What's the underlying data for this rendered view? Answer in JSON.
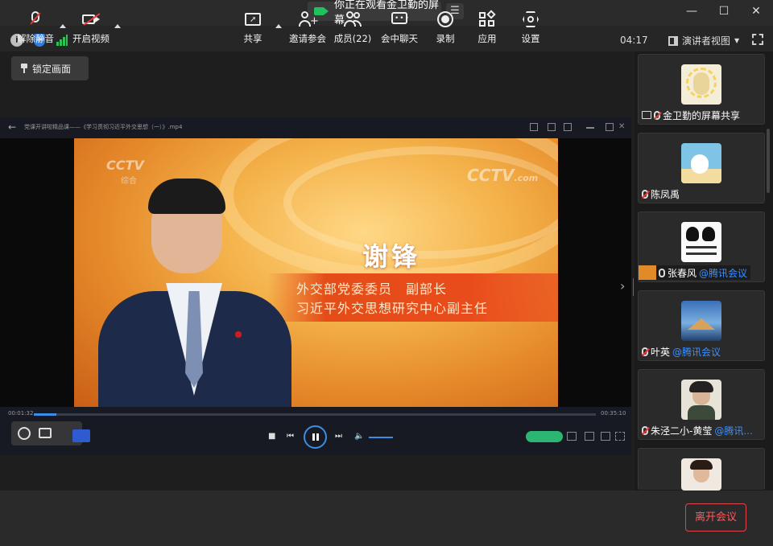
{
  "titlebar": {
    "sharing_text": "你正在观看金卫勤的屏幕"
  },
  "infobar": {
    "timer": "04:17",
    "view_mode": "演讲者视图"
  },
  "main": {
    "lock_label": "锁定画面"
  },
  "player": {
    "title": "党课开讲啦精品课——《学习贯彻习近平外交思想（一）》.mp4",
    "time_elapsed": "00:01:32",
    "time_total": "00:35:10",
    "progress_fraction": 0.04,
    "video": {
      "logo_left": "CCTV",
      "logo_left_sub": "综合",
      "logo_right": "CCTV",
      "logo_right_suffix": ".com",
      "speaker_name": "谢锋",
      "caption_line1": "外交部党委委员　副部长",
      "caption_line2": "习近平外交思想研究中心副主任"
    }
  },
  "participants": [
    {
      "name": "金卫勤的屏幕共享",
      "suffix": "",
      "mic": "muted"
    },
    {
      "name": "陈凤禹",
      "suffix": "",
      "mic": "muted"
    },
    {
      "name": "张春风",
      "suffix": "@腾讯会议",
      "mic": "on",
      "host": true
    },
    {
      "name": "叶英",
      "suffix": "@腾讯会议",
      "mic": "muted"
    },
    {
      "name": "朱泾二小-黄莹",
      "suffix": "@腾讯...",
      "mic": "muted"
    }
  ],
  "toolbar": {
    "unmute": "解除静音",
    "start_video": "开启视频",
    "share": "共享",
    "invite": "邀请参会",
    "members": "成员(22)",
    "chat": "会中聊天",
    "record": "录制",
    "apps": "应用",
    "settings": "设置",
    "leave": "离开会议"
  }
}
